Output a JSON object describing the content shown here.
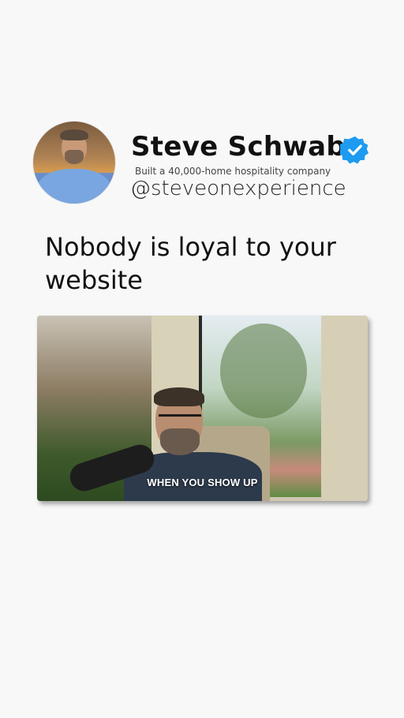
{
  "profile": {
    "name": "Steve Schwab",
    "subtitle": "Built a 40,000-home hospitality company",
    "handle": "@steveonexperience",
    "verified_color": "#1d9bf0"
  },
  "post": {
    "text": "Nobody is loyal to your website"
  },
  "video": {
    "caption": "WHEN YOU SHOW UP"
  },
  "icons": {
    "verified": "verified-badge-icon"
  }
}
